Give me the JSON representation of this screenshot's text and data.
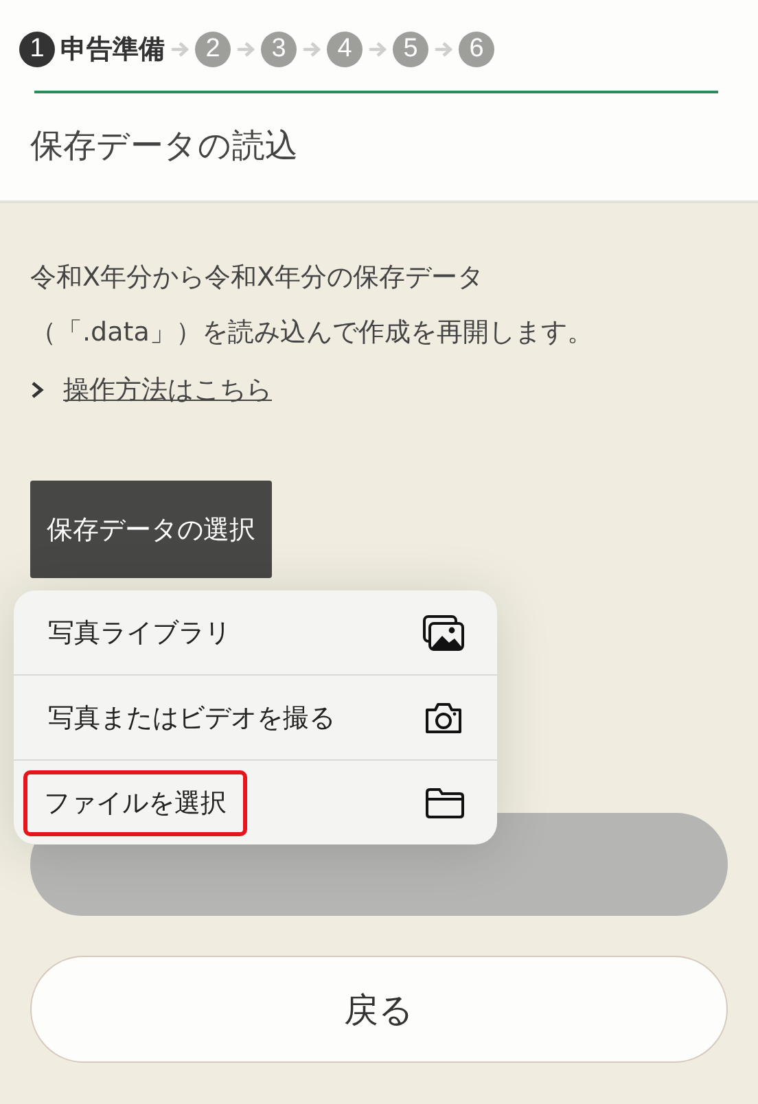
{
  "steps": [
    {
      "number": "1",
      "label": "申告準備",
      "selected": true
    },
    {
      "number": "2",
      "selected": false
    },
    {
      "number": "3",
      "selected": false
    },
    {
      "number": "4",
      "selected": false
    },
    {
      "number": "5",
      "selected": false
    },
    {
      "number": "6",
      "selected": false
    }
  ],
  "title": "保存データの読込",
  "description": [
    "令和X年分から令和X年分の保存データ",
    "（「.data」）を読み込んで作成を再開します。"
  ],
  "help_link": "操作方法はこちら",
  "select_button": "保存データの選択",
  "menu": [
    {
      "label": "写真ライブラリ",
      "kind": "photos",
      "highlighted": false
    },
    {
      "label": "写真またはビデオを撮る",
      "kind": "camera",
      "highlighted": false
    },
    {
      "label": "ファイルを選択",
      "kind": "folder",
      "highlighted": true
    }
  ],
  "load_button": {
    "disabled": true
  },
  "back_button": "戻る"
}
